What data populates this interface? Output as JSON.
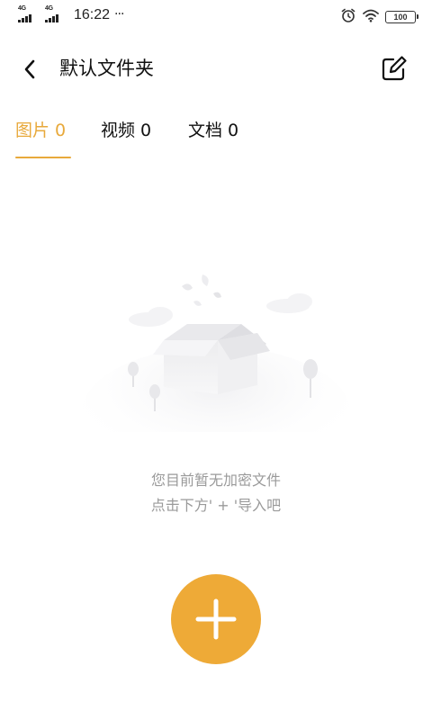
{
  "status_bar": {
    "signal1_label": "4G",
    "signal2_label": "4G",
    "time": "16:22",
    "more": "···",
    "battery": "100"
  },
  "header": {
    "title": "默认文件夹",
    "back_icon": "chevron-left-icon",
    "edit_icon": "edit-icon"
  },
  "tabs": [
    {
      "label": "图片 0",
      "active": true
    },
    {
      "label": "视频 0",
      "active": false
    },
    {
      "label": "文档 0",
      "active": false
    }
  ],
  "empty_state": {
    "line1": "您目前暂无加密文件",
    "line2": "点击下方' + '导入吧"
  },
  "colors": {
    "accent": "#eeaa37",
    "tab_active": "#e8a93b",
    "hint_text": "#9a9a9a"
  },
  "fab": {
    "icon": "plus-icon"
  }
}
